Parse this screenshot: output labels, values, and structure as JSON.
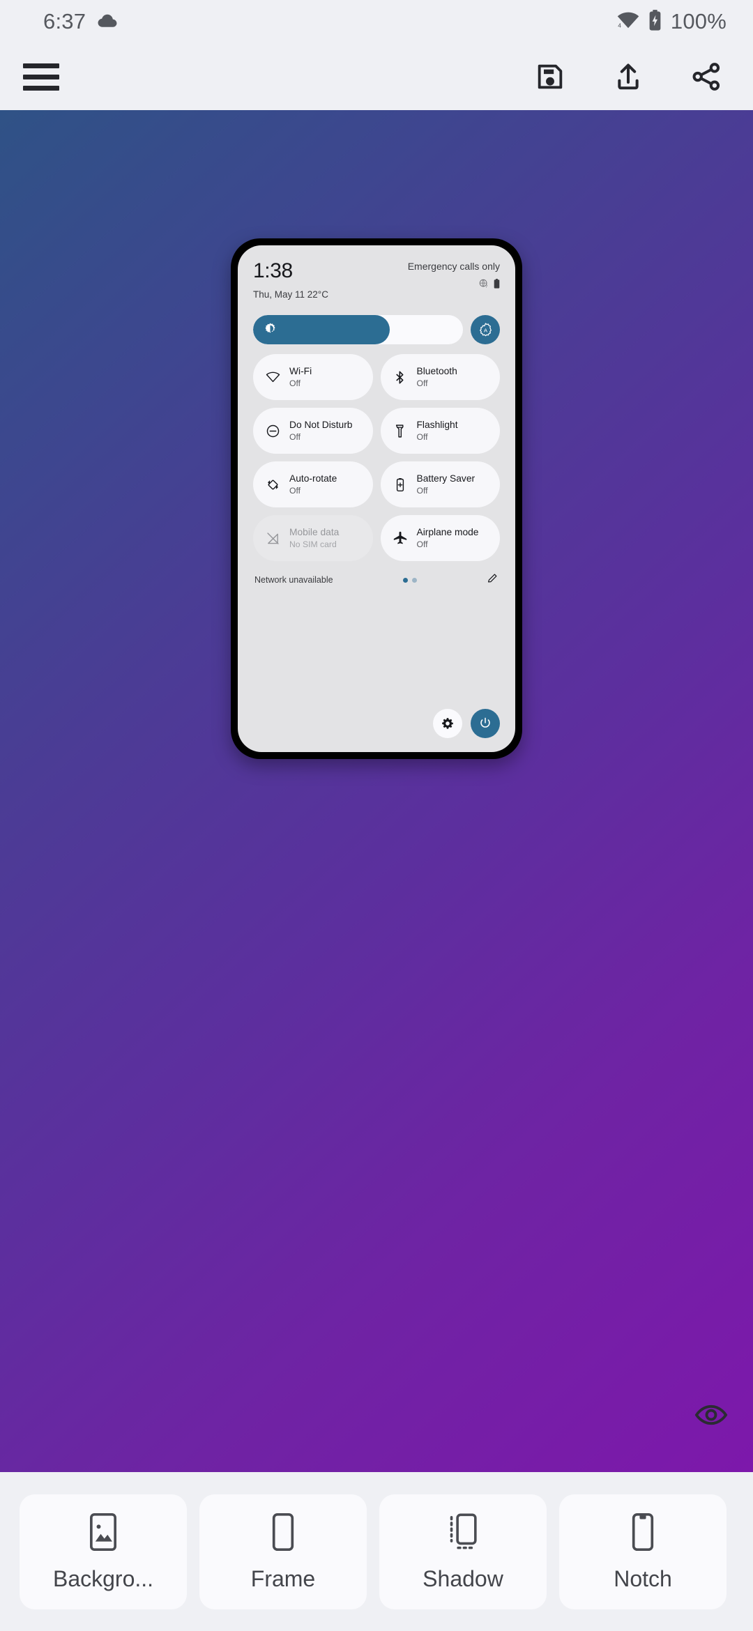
{
  "status_bar": {
    "time": "6:37",
    "weather_icon": "cloud-icon",
    "wifi_icon": "wifi-icon",
    "wifi_badge": "4",
    "battery_icon": "battery-charging-icon",
    "battery_percent": "100%"
  },
  "toolbar": {
    "menu_icon": "hamburger-menu-icon",
    "save_icon": "save-floppy-icon",
    "export_icon": "export-upload-icon",
    "share_icon": "share-icon"
  },
  "canvas": {
    "preview_icon": "eye-icon",
    "gradient_from": "#2f5286",
    "gradient_to": "#7d18ab"
  },
  "mockup": {
    "clock": "1:38",
    "date": "Thu, May 11 22°C",
    "carrier": "Emergency calls only",
    "head_icons": [
      "globe-question-icon",
      "battery-icon"
    ],
    "brightness": {
      "icon": "brightness-icon",
      "level_percent": 65,
      "auto_icon": "auto-brightness-icon",
      "fill_color": "#2c6d93"
    },
    "tiles": [
      {
        "label": "Wi-Fi",
        "sub": "Off",
        "icon": "wifi-off-icon",
        "disabled": false
      },
      {
        "label": "Bluetooth",
        "sub": "Off",
        "icon": "bluetooth-icon",
        "disabled": false
      },
      {
        "label": "Do Not Disturb",
        "sub": "Off",
        "icon": "do-not-disturb-icon",
        "disabled": false
      },
      {
        "label": "Flashlight",
        "sub": "Off",
        "icon": "flashlight-icon",
        "disabled": false
      },
      {
        "label": "Auto-rotate",
        "sub": "Off",
        "icon": "auto-rotate-icon",
        "disabled": false
      },
      {
        "label": "Battery Saver",
        "sub": "Off",
        "icon": "battery-saver-icon",
        "disabled": false
      },
      {
        "label": "Mobile data",
        "sub": "No SIM card",
        "icon": "mobile-data-off-icon",
        "disabled": true
      },
      {
        "label": "Airplane mode",
        "sub": "Off",
        "icon": "airplane-icon",
        "disabled": false
      }
    ],
    "footer": {
      "network_status": "Network unavailable",
      "page_dots": 2,
      "active_dot": 0,
      "edit_icon": "pencil-edit-icon"
    },
    "bottom": {
      "settings_icon": "gear-icon",
      "power_icon": "power-icon"
    }
  },
  "tabbar": {
    "tabs": [
      {
        "label": "Backgro...",
        "icon": "image-background-icon"
      },
      {
        "label": "Frame",
        "icon": "phone-frame-icon"
      },
      {
        "label": "Shadow",
        "icon": "shadow-icon"
      },
      {
        "label": "Notch",
        "icon": "notch-icon"
      }
    ]
  }
}
